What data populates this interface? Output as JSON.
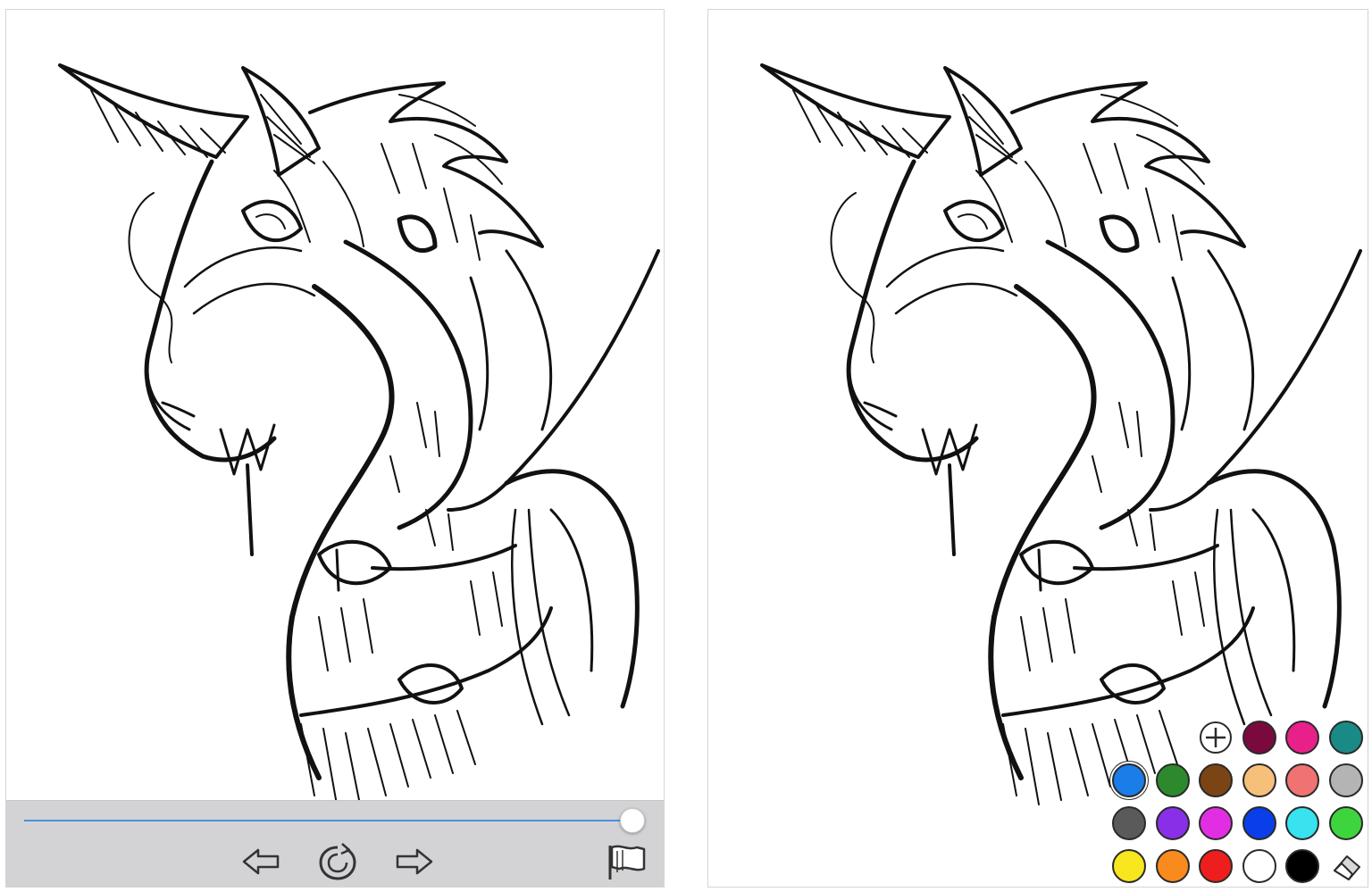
{
  "screens": [
    {
      "id": "playback",
      "toolbar": {
        "slider": {
          "value": 1.0,
          "accent": "#4a90e2"
        },
        "buttons": [
          {
            "name": "back-arrow-icon",
            "label": "previous"
          },
          {
            "name": "replay-icon",
            "label": "replay"
          },
          {
            "name": "forward-arrow-icon",
            "label": "next"
          },
          {
            "name": "flag-icon",
            "label": "flag"
          }
        ]
      }
    },
    {
      "id": "palette",
      "palette": {
        "add_button": {
          "icon": "plus-icon"
        },
        "eraser_button": {
          "icon": "eraser-icon"
        },
        "colors": [
          "#7a0a3e",
          "#e8208a",
          "#1a8a86",
          "#1a7de8",
          "#2c8a2c",
          "#7a4414",
          "#f6c07a",
          "#f07272",
          "#b4b4b4",
          "#5a5a5a",
          "#8a2fe8",
          "#e22ee2",
          "#0a3ee8",
          "#38e2ee",
          "#3ed43e",
          "#f8e61e",
          "#f88a1e",
          "#ee1e1e",
          "#ffffff",
          "#000000"
        ],
        "selected_color": "#1a7de8"
      }
    }
  ]
}
